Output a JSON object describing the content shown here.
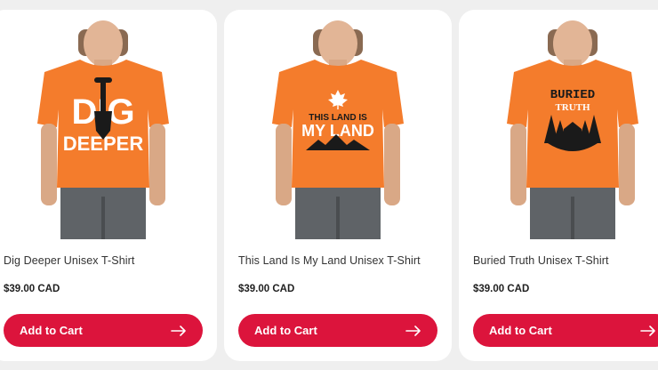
{
  "products": [
    {
      "title": "Dig Deeper Unisex T-Shirt",
      "price": "$39.00 CAD",
      "button_label": "Add to Cart",
      "graphic_lines": [
        "DIG",
        "DEEPER"
      ],
      "graphic_icon": "shovel-icon"
    },
    {
      "title": "This Land Is My Land Unisex T-Shirt",
      "price": "$39.00 CAD",
      "button_label": "Add to Cart",
      "graphic_lines": [
        "THIS LAND IS",
        "MY LAND"
      ],
      "graphic_icon": "maple-leaf-icon"
    },
    {
      "title": "Buried Truth Unisex T-Shirt",
      "price": "$39.00 CAD",
      "button_label": "Add to Cart",
      "graphic_lines": [
        "BURIED",
        "TRUTH"
      ],
      "graphic_icon": "forest-house-icon"
    }
  ],
  "colors": {
    "shirt": "#f47c2c",
    "button": "#dc143c",
    "card": "#ffffff",
    "page_bg": "#efefef"
  }
}
